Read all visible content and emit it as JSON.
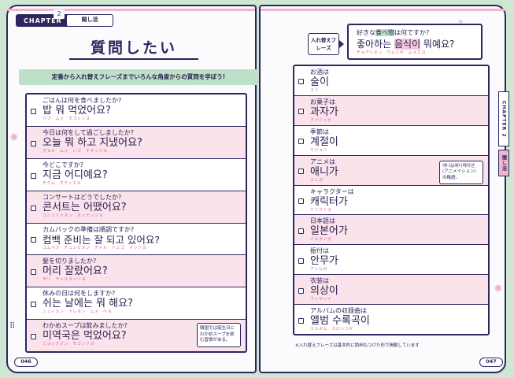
{
  "left": {
    "chapter_label": "CHAPTER",
    "chapter_num": "2",
    "section_tag": "聞し活",
    "title": "質問したい",
    "intro": "定番から入れ替えフレーズまでいろんな角度からの質問を学ぼう!",
    "page_number": "046",
    "questions": [
      {
        "jp": "ごはんは何を食べましたか?",
        "ko": "밥 뭐 먹었어요?",
        "ruby": "パプ　ムォ　モゴッソヨ"
      },
      {
        "jp": "今日は何をして過ごしましたか?",
        "ko": "오늘 뭐 하고 지냈어요?",
        "ruby": "オヌル　ムォ　ハゴ　チネッソヨ"
      },
      {
        "jp": "今どこですか?",
        "ko": "지금 어디예요?",
        "ruby": "チグム　オディエヨ"
      },
      {
        "jp": "コンサートはどうでしたか?",
        "ko": "콘서트는 어땠어요?",
        "ruby": "コンソトゥヌン　オッテッソヨ"
      },
      {
        "jp": "カムバックの準備は順調ですか?",
        "ko": "컴백 준비는 잘 되고 있어요?",
        "ruby": "コムペク　チュンビヌン　チャル　トェゴ　イッソヨ"
      },
      {
        "jp": "髪を切りましたか?",
        "ko": "머리 잘랐어요?",
        "ruby": "モリ　チャルラッソヨ"
      },
      {
        "jp": "休みの日は何をしますか?",
        "ko": "쉬는 날에는 뭐 해요?",
        "ruby": "シュィヌン　ナレヌン　ムォ　ヘヨ"
      },
      {
        "jp": "わかめスープは飲みましたか?",
        "ko": "미역국은 먹었어요?",
        "ruby": "ミヨックグン　モゴッソヨ"
      }
    ],
    "note": "韓国では誕生日にわかめスープを飲む習慣がある。"
  },
  "right": {
    "example_tag": "入れ替えフレーズ",
    "example_jp_pre": "好きな",
    "example_jp_hl": "食べ物",
    "example_jp_post": "は何ですか?",
    "example_ko_pre": "좋아하는 ",
    "example_ko_hl": "음식이",
    "example_ko_post": " 뭐예요?",
    "example_ruby": "チョアハヌン　ウムシギ　ムォエヨ",
    "side_tab_chapter": "CHAPTER 2",
    "side_tab_section": "聞し活",
    "page_number": "047",
    "footnote": "※入れ替えフレーズは基本的に助詞もつけた形で掲載しています",
    "note": "애니は애니메이션(アニメイション)の略語。",
    "phrases": [
      {
        "jp": "お酒は",
        "ko": "술이",
        "ruby": "スリ"
      },
      {
        "jp": "お菓子は",
        "ko": "과자가",
        "ruby": "クァジャガ"
      },
      {
        "jp": "季節は",
        "ko": "계절이",
        "ruby": "ケジョリ"
      },
      {
        "jp": "アニメは",
        "ko": "애니가",
        "ruby": "エニガ"
      },
      {
        "jp": "キャラクターは",
        "ko": "캐릭터가",
        "ruby": "ケリクトガ"
      },
      {
        "jp": "日本語は",
        "ko": "일본어가",
        "ruby": "イルボノガ"
      },
      {
        "jp": "振付は",
        "ko": "안무가",
        "ruby": "アンムガ"
      },
      {
        "jp": "衣装は",
        "ko": "의상이",
        "ruby": "ウィサンイ"
      },
      {
        "jp": "アルバムの収録曲は",
        "ko": "앨범 수록곡이",
        "ruby": "エルボム　スロッコギ"
      }
    ]
  },
  "colors": {
    "navy": "#2d2660",
    "pink": "#f2b5ce",
    "mint": "#cfe7d2",
    "row_pink": "#fbe3ec"
  }
}
